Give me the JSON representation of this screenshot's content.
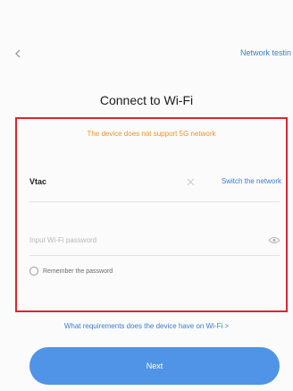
{
  "header": {
    "back_icon": "chevron-left-icon",
    "network_test_label": "Network testin"
  },
  "title": "Connect to Wi-Fi",
  "warning": "The device does not support 5G network",
  "wifi": {
    "ssid": "Vtac",
    "clear_icon": "close-icon",
    "switch_label": "Switch the network"
  },
  "password": {
    "value": "",
    "placeholder": "Input Wi-Fi password",
    "toggle_icon": "eye-icon"
  },
  "remember": {
    "label": "Remember the password",
    "checked": false
  },
  "requirements_link": "What requirements does the device have on Wi-Fi >",
  "next_button": "Next",
  "colors": {
    "accent": "#3a7bd5",
    "button": "#4f94e6",
    "warning": "#e8952a",
    "highlight_frame": "#e0252c"
  }
}
